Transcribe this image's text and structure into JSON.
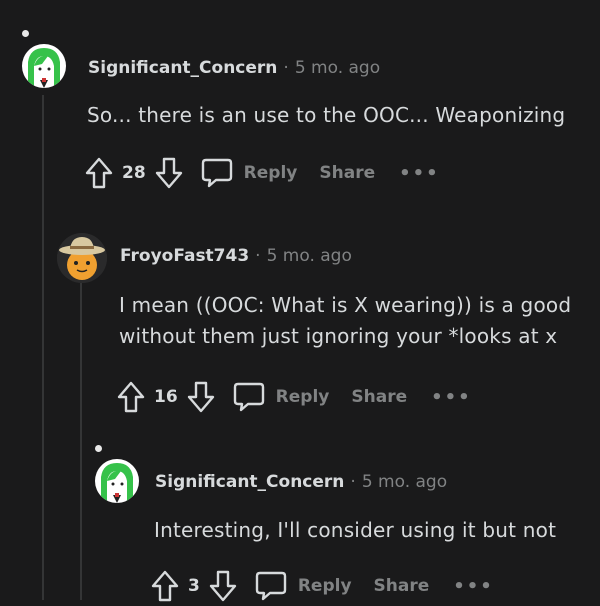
{
  "comments": [
    {
      "username": "Significant_Concern",
      "separator": "·",
      "time": "5 mo. ago",
      "body_lines": [
        "So... there is an use to the OOC... Weaponizing"
      ],
      "votes": "28",
      "reply_label": "Reply",
      "share_label": "Share",
      "more_label": "•••",
      "avatar": "green-hair-character-icon"
    },
    {
      "username": "FroyoFast743",
      "separator": "·",
      "time": "5 mo. ago",
      "body_lines": [
        "I mean ((OOC: What is X wearing)) is a good",
        "without them just ignoring your *looks at x"
      ],
      "votes": "16",
      "reply_label": "Reply",
      "share_label": "Share",
      "more_label": "•••",
      "avatar": "cowboy-snoo-icon"
    },
    {
      "username": "Significant_Concern",
      "separator": "·",
      "time": "5 mo. ago",
      "body_lines": [
        "Interesting, I'll consider using it but not"
      ],
      "votes": "3",
      "reply_label": "Reply",
      "share_label": "Share",
      "more_label": "•••",
      "avatar": "green-hair-character-icon"
    }
  ],
  "colors": {
    "background": "#1a1a1b",
    "text": "#d7dadc",
    "muted": "#818384",
    "thread_line": "#343536"
  }
}
